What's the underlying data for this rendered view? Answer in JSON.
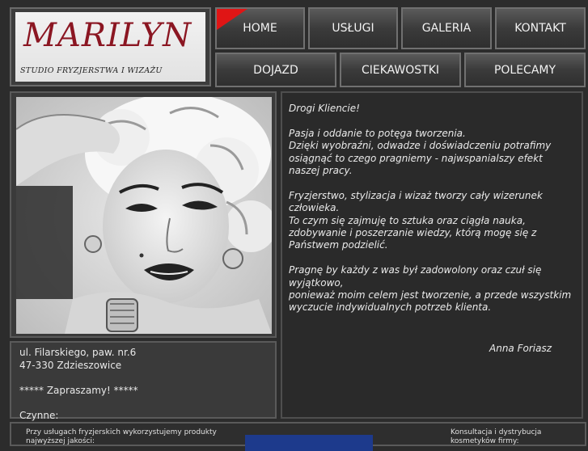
{
  "logo": {
    "title": "MARILYN",
    "subtitle": "STUDIO FRYZJERSTWA I WIZAŻU"
  },
  "nav": {
    "row1": [
      "HOME",
      "USŁUGI",
      "GALERIA",
      "KONTAKT"
    ],
    "row2": [
      "DOJAZD",
      "CIEKAWOSTKI",
      "POLECAMY"
    ]
  },
  "message": {
    "greeting": "Drogi Kliencie!",
    "p1_l1": "Pasja i oddanie to potęga tworzenia.",
    "p1_l2": "Dzięki wyobraźni, odwadze i doświadczeniu potrafimy osiągnąć to czego pragniemy - najwspanialszy efekt naszej pracy.",
    "p2_l1": "Fryzjerstwo, stylizacja i wizaż tworzy cały wizerunek człowieka.",
    "p2_l2": "To czym się zajmuję to sztuka oraz ciągła nauka, zdobywanie i poszerzanie wiedzy, którą mogę się z Państwem podzielić.",
    "p3_l1": "Pragnę by każdy z was był zadowolony oraz czuł się wyjątkowo,",
    "p3_l2": "ponieważ moim celem jest tworzenie, a przede wszystkim wyczucie indywidualnych potrzeb klienta.",
    "signature": "Anna Foriasz"
  },
  "address": {
    "line1": "ul. Filarskiego, paw. nr.6",
    "line2": "47-330 Zdzieszowice",
    "invite": "***** Zapraszamy! *****",
    "hours_label": "Czynne:"
  },
  "footer": {
    "left": "Przy usługach fryzjerskich wykorzystujemy produkty najwyższej jakości:",
    "right": "Konsultacja i dystrybucja kosmetyków firmy:"
  },
  "colors": {
    "accent_red": "#e01515",
    "logo_red": "#8b1622",
    "background": "#2c2c2c"
  }
}
